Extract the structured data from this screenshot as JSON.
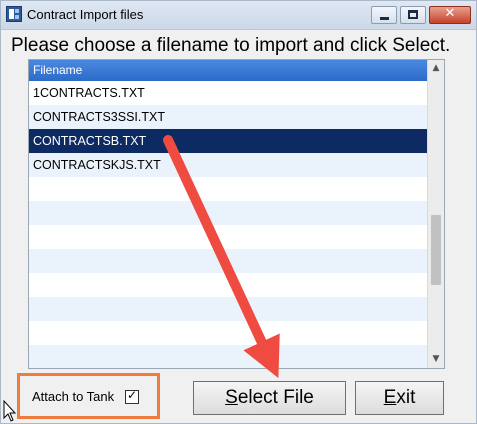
{
  "window": {
    "title": "Contract Import files",
    "close_glyph": "✕"
  },
  "instruction": "Please choose a filename to import and click Select.",
  "list": {
    "header": "Filename",
    "files": [
      "1CONTRACTS.TXT",
      "CONTRACTS3SSI.TXT",
      "CONTRACTSB.TXT",
      "CONTRACTSKJS.TXT"
    ],
    "selected_index": 2,
    "scroll_up_glyph": "▲",
    "scroll_down_glyph": "▼"
  },
  "attach": {
    "label": "Attach to Tank",
    "checked": true,
    "check_glyph": "✓"
  },
  "buttons": {
    "select_mnemonic": "S",
    "select_rest": "elect File",
    "exit_mnemonic": "E",
    "exit_rest": "xit"
  },
  "icons": {
    "app": "app-icon",
    "minimize": "minimize-icon",
    "maximize": "maximize-icon",
    "close": "close-icon",
    "cursor": "mouse-cursor-icon"
  },
  "colors": {
    "header_blue": "#2d6bc9",
    "selected_row": "#0d2a63",
    "row_stripe": "#eaf3fb",
    "highlight_orange": "#f07b3f",
    "arrow_red": "#ef4b41",
    "close_red": "#c7422b"
  }
}
